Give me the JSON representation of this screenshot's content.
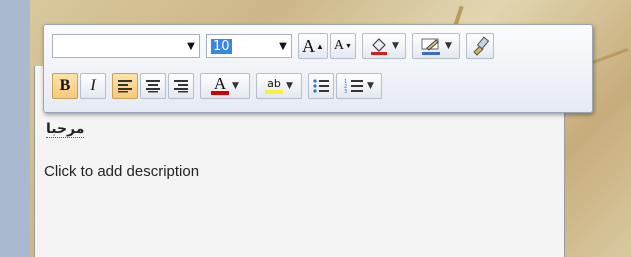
{
  "toolbar": {
    "font_name": "",
    "font_size": "10",
    "grow_font_label": "A",
    "shrink_font_label": "A",
    "bold_label": "B",
    "italic_label": "I",
    "font_color_label": "A",
    "highlight_label": "ab"
  },
  "panel": {
    "title": "مرحبا",
    "description": "Click to add description"
  },
  "colors": {
    "fill": "#d42020",
    "line": "#3c6cc8",
    "font_color": "#d40000",
    "highlight": "#f7f040"
  }
}
